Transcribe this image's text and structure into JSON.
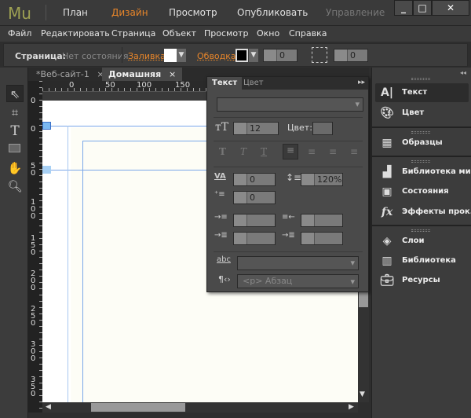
{
  "app": {
    "logo": "Mu",
    "workspace_tabs": [
      {
        "label": "План",
        "active": false
      },
      {
        "label": "Дизайн",
        "active": true
      },
      {
        "label": "Просмотр",
        "active": false
      },
      {
        "label": "Опубликовать",
        "active": false
      },
      {
        "label": "Управление",
        "active": false,
        "disabled": true
      }
    ],
    "window_controls": {
      "minimize": "_",
      "maximize": "□",
      "close": "✕"
    }
  },
  "menu": [
    "Файл",
    "Редактировать",
    "Страница",
    "Объект",
    "Просмотр",
    "Окно",
    "Справка"
  ],
  "control_bar": {
    "page_label": "Страница:",
    "page_state": "Нет состояния",
    "fill_label": "Заливка:",
    "fill_color": "#ffffff",
    "stroke_label": "Обводка:",
    "stroke_width": "0",
    "corner_radius": "0"
  },
  "doc_tabs": [
    {
      "label": "*Веб-сайт-1",
      "close": "×"
    },
    {
      "label": "Домашняя",
      "close": "×",
      "active": true
    }
  ],
  "ruler": {
    "top": [
      "0",
      "50",
      "100",
      "150"
    ],
    "left": [
      "0",
      "0",
      "50",
      "100",
      "150",
      "200",
      "250",
      "300",
      "350"
    ]
  },
  "text_panel": {
    "tabs": [
      "Текст",
      "Цвет"
    ],
    "font": "",
    "font_size": "12",
    "color_label": "Цвет:",
    "tracking": "0",
    "leading": "120%",
    "indent": "0",
    "paragraph_style": "<p> Абзац",
    "link_style": ""
  },
  "right_panel": {
    "groups": [
      [
        {
          "icon": "text-icon",
          "label": "Текст",
          "active": true
        },
        {
          "icon": "palette-icon",
          "label": "Цвет"
        }
      ],
      [
        {
          "icon": "swatches-icon",
          "label": "Образцы"
        }
      ],
      [
        {
          "icon": "widgets-library-icon",
          "label": "Библиотека ми..."
        },
        {
          "icon": "states-icon",
          "label": "Состояния"
        },
        {
          "icon": "fx-icon",
          "label": "Эффекты прок..."
        }
      ],
      [
        {
          "icon": "layers-icon",
          "label": "Слои"
        },
        {
          "icon": "library-icon",
          "label": "Библиотека"
        },
        {
          "icon": "assets-icon",
          "label": "Ресурсы"
        }
      ]
    ]
  },
  "colors": {
    "accent": "#e8862a",
    "logo": "#9ea153",
    "guide": "#7aa7e8",
    "page": "#fdfdf6"
  }
}
